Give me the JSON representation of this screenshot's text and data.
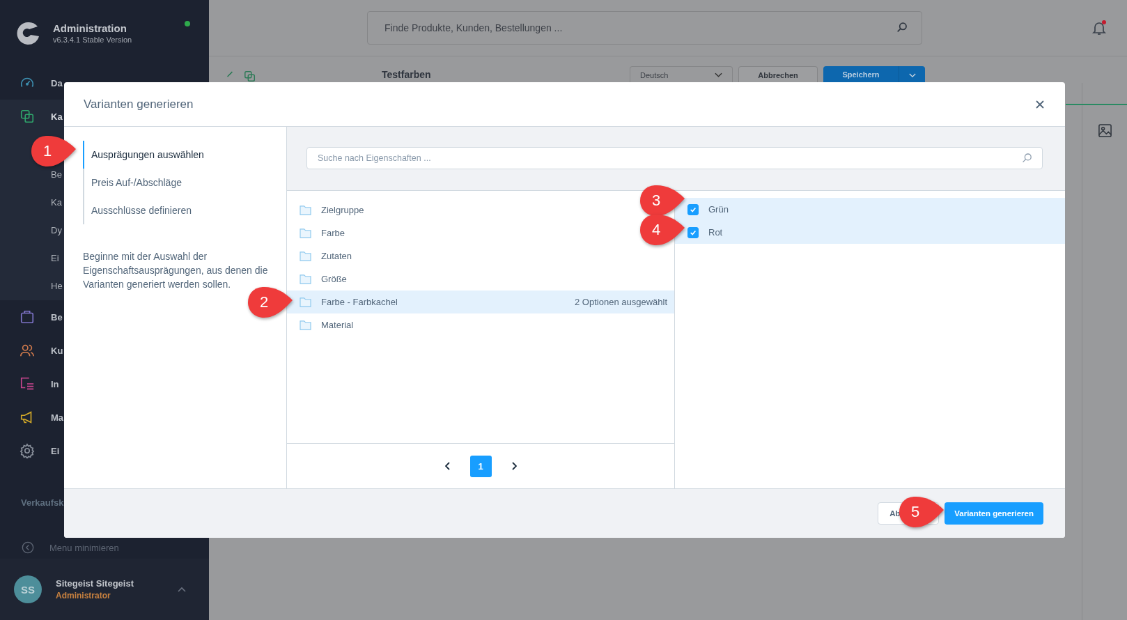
{
  "sidebar": {
    "brand": {
      "title": "Administration",
      "version": "v6.3.4.1 Stable Version",
      "online": true
    },
    "nav": [
      {
        "label": "Da",
        "expanded": false
      },
      {
        "label": "Ka",
        "expanded": true,
        "children": [
          {
            "label": "Be"
          },
          {
            "label": "Ka"
          },
          {
            "label": "Dy"
          },
          {
            "label": "Ei"
          },
          {
            "label": "He"
          }
        ]
      },
      {
        "label": "Be",
        "expanded": false
      },
      {
        "label": "Ku",
        "expanded": false
      },
      {
        "label": "In",
        "expanded": false
      },
      {
        "label": "Ma",
        "expanded": false
      },
      {
        "label": "Ei",
        "expanded": false
      }
    ],
    "section": "Verkaufsk",
    "collapse": "Menu minimieren",
    "user": {
      "initials": "SS",
      "name": "Sitegeist Sitegeist",
      "role": "Administrator"
    }
  },
  "topbar": {
    "search": {
      "placeholder": "Finde Produkte, Kunden, Bestellungen ..."
    },
    "notifications": true
  },
  "toolbar": {
    "title": "Testfarben",
    "language": "Deutsch",
    "cancel": "Abbrechen",
    "save": "Speichern"
  },
  "modal": {
    "title": "Varianten generieren",
    "steps": [
      {
        "label": "Ausprägungen auswählen",
        "selected": true
      },
      {
        "label": "Preis Auf-/Abschläge",
        "selected": false
      },
      {
        "label": "Ausschlüsse definieren",
        "selected": false
      }
    ],
    "hint": "Beginne mit der Auswahl der Eigenschaftsausprägungen, aus denen die Varianten generiert werden sollen.",
    "search": {
      "placeholder": "Suche nach Eigenschaften ..."
    },
    "properties": [
      {
        "label": "Zielgruppe",
        "selected": false
      },
      {
        "label": "Farbe",
        "selected": false
      },
      {
        "label": "Zutaten",
        "selected": false
      },
      {
        "label": "Größe",
        "selected": false
      },
      {
        "label": "Farbe - Farbkachel",
        "selected": true,
        "note": "2 Optionen ausgewählt"
      },
      {
        "label": "Material",
        "selected": false
      }
    ],
    "options": [
      {
        "label": "Grün",
        "checked": true
      },
      {
        "label": "Rot",
        "checked": true
      }
    ],
    "pages": [
      {
        "label": "1",
        "selected": true
      }
    ],
    "cancel": "Ab",
    "submit": "Varianten generieren"
  },
  "annotations": [
    {
      "label": "1"
    },
    {
      "label": "2"
    },
    {
      "label": "3"
    },
    {
      "label": "4"
    },
    {
      "label": "5"
    }
  ]
}
